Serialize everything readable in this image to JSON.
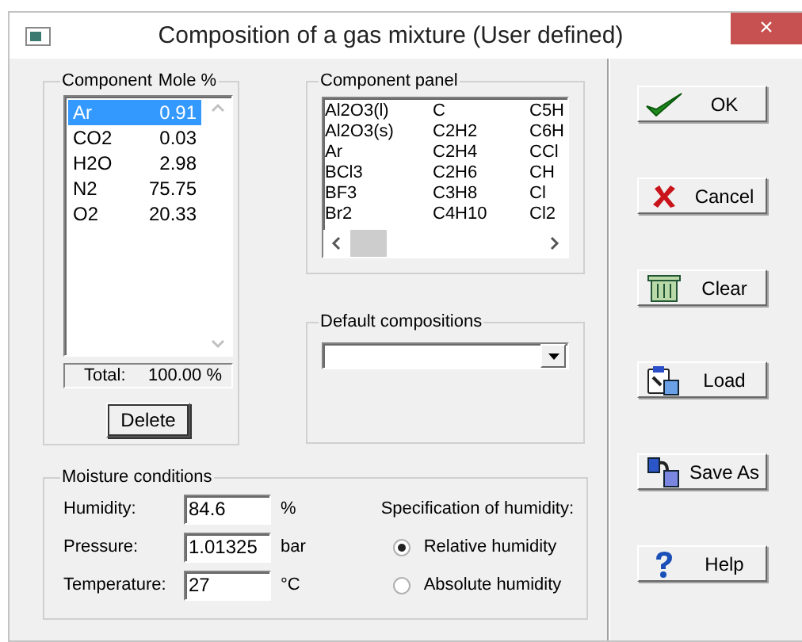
{
  "window": {
    "title": "Composition of a gas mixture (User defined)",
    "close": "×"
  },
  "components": {
    "headers": [
      "Component",
      "Mole %"
    ],
    "rows": [
      {
        "name": "Ar",
        "value": "0.91",
        "selected": true
      },
      {
        "name": "CO2",
        "value": "0.03",
        "selected": false
      },
      {
        "name": "H2O",
        "value": "2.98",
        "selected": false
      },
      {
        "name": "N2",
        "value": "75.75",
        "selected": false
      },
      {
        "name": "O2",
        "value": "20.33",
        "selected": false
      }
    ],
    "total_label": "Total:",
    "total_value": "100.00 %",
    "delete_button": "Delete"
  },
  "component_panel": {
    "legend": "Component panel",
    "columns": [
      [
        "Al2O3(l)",
        "Al2O3(s)",
        "Ar",
        "BCl3",
        "BF3",
        "Br2"
      ],
      [
        "C",
        "C2H2",
        "C2H4",
        "C2H6",
        "C3H8",
        "C4H10"
      ],
      [
        "C5H",
        "C6H",
        "CCl",
        "CH",
        "Cl",
        "Cl2"
      ]
    ]
  },
  "default_compositions": {
    "legend": "Default compositions"
  },
  "moisture": {
    "legend": "Moisture conditions",
    "fields": [
      {
        "label": "Humidity:",
        "value": "84.6",
        "unit": "%"
      },
      {
        "label": "Pressure:",
        "value": "1.01325",
        "unit": "bar"
      },
      {
        "label": "Temperature:",
        "value": "27",
        "unit": "°C"
      }
    ],
    "specification_label": "Specification of humidity:",
    "options": [
      {
        "label": "Relative humidity",
        "selected": true
      },
      {
        "label": "Absolute humidity",
        "selected": false
      }
    ]
  },
  "buttons": [
    {
      "kind": "ok",
      "label": "OK"
    },
    {
      "kind": "cancel",
      "label": "Cancel"
    },
    {
      "kind": "clear",
      "label": "Clear"
    },
    {
      "kind": "load",
      "label": "Load"
    },
    {
      "kind": "saveas",
      "label": "Save As"
    },
    {
      "kind": "help",
      "label": "Help"
    }
  ]
}
